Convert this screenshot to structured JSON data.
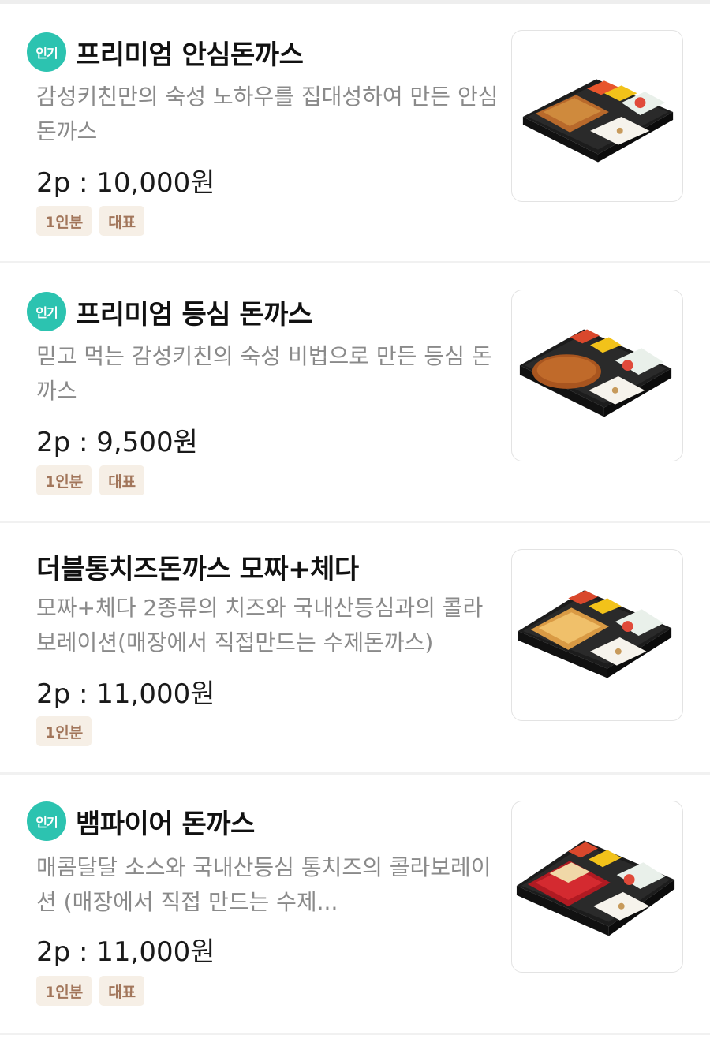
{
  "menu": {
    "items": [
      {
        "popular_badge": "인기",
        "title": "프리미엄 안심돈까스",
        "description": "감성키친만의 숙성 노하우를 집대성하여 만든 안심 돈까스",
        "price": "2p : 10,000원",
        "tags": [
          "1인분",
          "대표"
        ],
        "image_icon": "bento-box-image"
      },
      {
        "popular_badge": "인기",
        "title": "프리미엄 등심 돈까스",
        "description": "믿고 먹는 감성키친의 숙성 비법으로 만든 등심 돈까스",
        "price": "2p : 9,500원",
        "tags": [
          "1인분",
          "대표"
        ],
        "image_icon": "bento-box-image"
      },
      {
        "title": "더블통치즈돈까스 모짜+체다",
        "description": "모짜+체다 2종류의 치즈와 국내산등심과의 콜라보레이션(매장에서 직접만드는 수제돈까스)",
        "price": "2p : 11,000원",
        "tags": [
          "1인분"
        ],
        "image_icon": "bento-box-image"
      },
      {
        "popular_badge": "인기",
        "title": "뱀파이어 돈까스",
        "description": "매콤달달 소스와 국내산등심 통치즈의 콜라보레이션 (매장에서 직접 만드는 수제...",
        "price": "2p : 11,000원",
        "tags": [
          "1인분",
          "대표"
        ],
        "image_icon": "bento-box-image"
      }
    ]
  },
  "colors": {
    "popular_badge": "#2cc3b0",
    "tag_bg": "#f6efe6",
    "tag_text": "#a2765b",
    "desc_text": "#8a8a8a"
  }
}
